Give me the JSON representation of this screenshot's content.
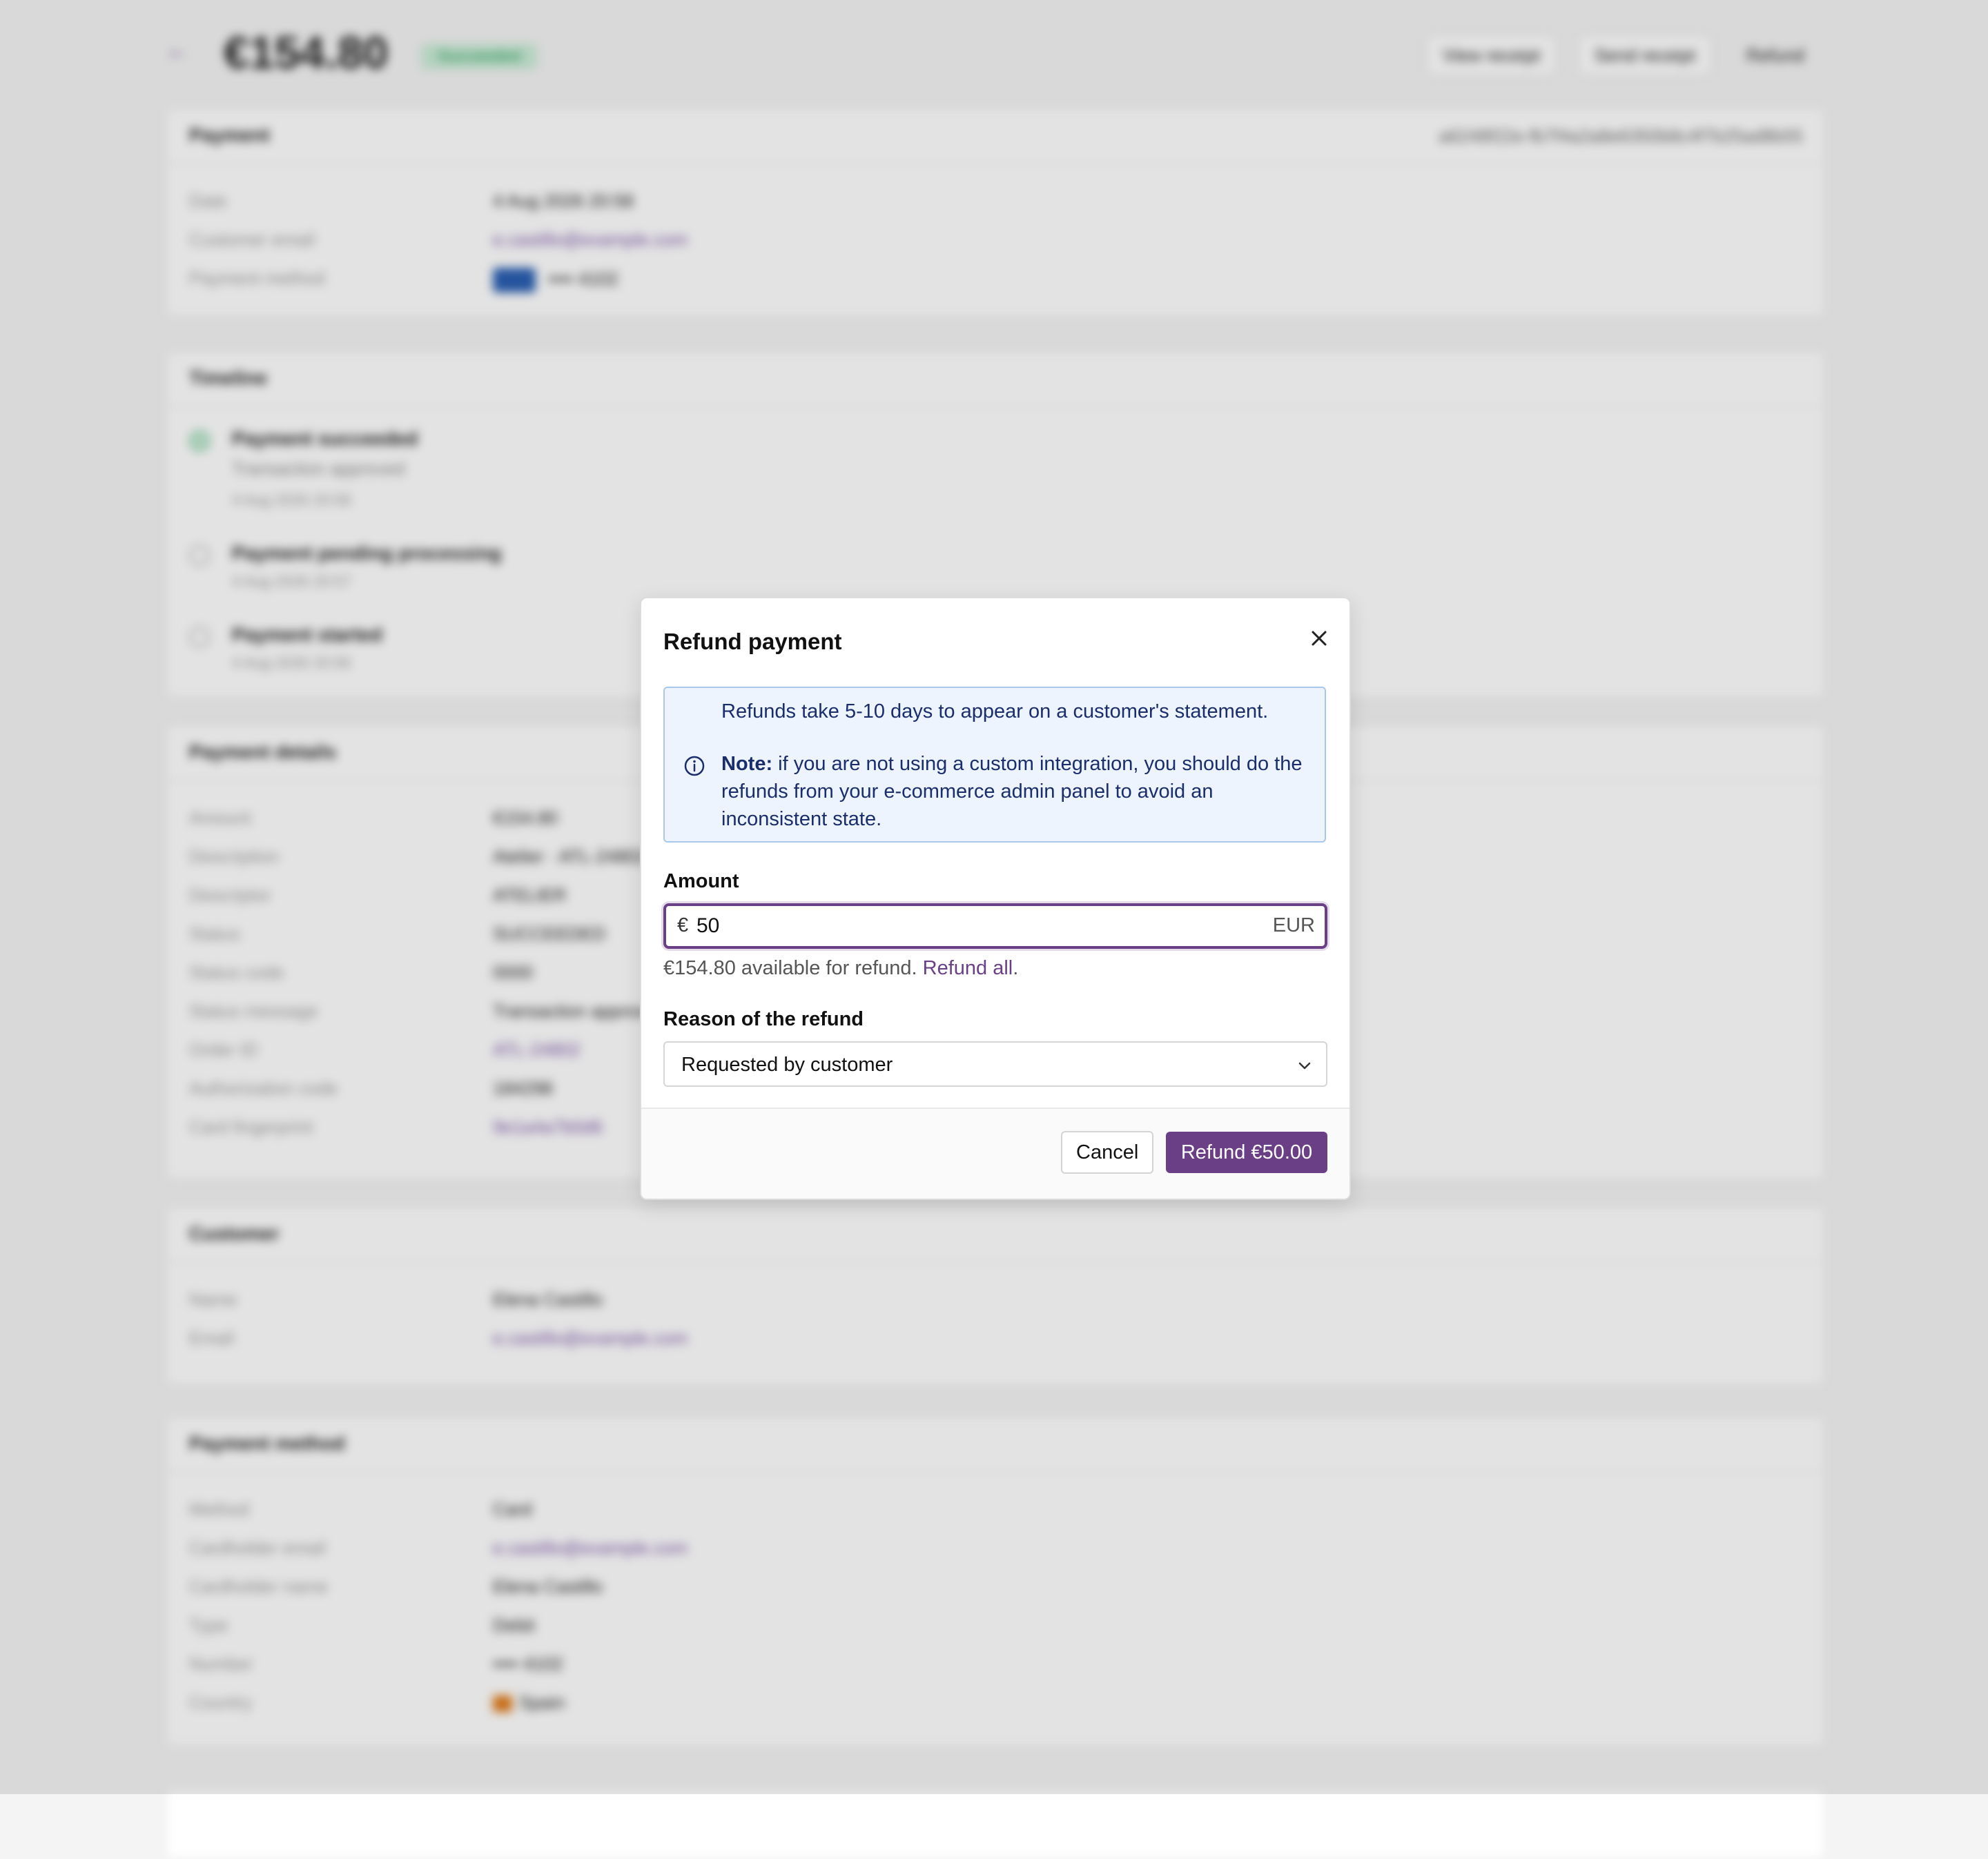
{
  "header": {
    "amount": "€154.80",
    "status": "Succeeded",
    "buttons": [
      "View receipt",
      "Send receipt",
      "Refund"
    ]
  },
  "payment_card": {
    "title": "Payment",
    "id": "a6248f22e-fb7f4a2a8e6350b8c4f7b25ad8b55",
    "rows": [
      {
        "label": "Date",
        "value": "4 Aug 2026 20:58"
      },
      {
        "label": "Customer email",
        "value": "e.castillo@example.com"
      },
      {
        "label": "Payment method",
        "value": "•••• 4102"
      }
    ]
  },
  "timeline": {
    "title": "Timeline",
    "events": [
      {
        "title": "Payment succeeded",
        "subtitle": "Transaction approved",
        "date": "4 Aug 2026 20:58"
      },
      {
        "title": "Payment pending processing",
        "date": "4 Aug 2026 20:57"
      },
      {
        "title": "Payment started",
        "date": "4 Aug 2026 20:56"
      }
    ]
  },
  "details_card": {
    "title": "Payment details",
    "rows": [
      {
        "label": "Amount",
        "value": "€154.80"
      },
      {
        "label": "Description",
        "value": "Atelier · ATL-24802"
      },
      {
        "label": "Descriptor",
        "value": "ATELIER"
      },
      {
        "label": "Status",
        "value": "SUCCEEDED"
      },
      {
        "label": "Status code",
        "value": "0000"
      },
      {
        "label": "Status message",
        "value": "Transaction approved"
      },
      {
        "label": "Order ID",
        "value": "ATL-24802"
      },
      {
        "label": "Authorization code",
        "value": "184298"
      },
      {
        "label": "Card fingerprint",
        "value": "9e1a4a7b0d6"
      }
    ]
  },
  "customer_card": {
    "title": "Customer",
    "rows": [
      {
        "label": "Name",
        "value": "Elena Castillo"
      },
      {
        "label": "Email",
        "value": "e.castillo@example.com"
      }
    ]
  },
  "method_card": {
    "title": "Payment method",
    "rows": [
      {
        "label": "Method",
        "value": "Card"
      },
      {
        "label": "Cardholder email",
        "value": "e.castillo@example.com"
      },
      {
        "label": "Cardholder name",
        "value": "Elena Castillo"
      },
      {
        "label": "Type",
        "value": "Debit"
      },
      {
        "label": "Number",
        "value": "•••• 4102"
      },
      {
        "label": "Country",
        "value": "Spain"
      }
    ]
  },
  "modal": {
    "title": "Refund payment",
    "notice_line1": "Refunds take 5-10 days to appear on a customer's statement.",
    "notice_note_label": "Note:",
    "notice_note_text": " if you are not using a custom integration, you should do the refunds from your e-commerce admin panel to avoid an inconsistent state.",
    "amount_label": "Amount",
    "currency_symbol": "€",
    "amount_value": "50",
    "currency_code": "EUR",
    "available_text": "€154.80 available for refund. ",
    "refund_all_label": "Refund all",
    "refund_all_suffix": ".",
    "reason_label": "Reason of the refund",
    "reason_value": "Requested by customer",
    "cancel_label": "Cancel",
    "submit_label": "Refund €50.00"
  },
  "colors": {
    "accent": "#6b3f86",
    "notice_bg": "#edf4fd",
    "notice_text": "#1a2e6e"
  }
}
